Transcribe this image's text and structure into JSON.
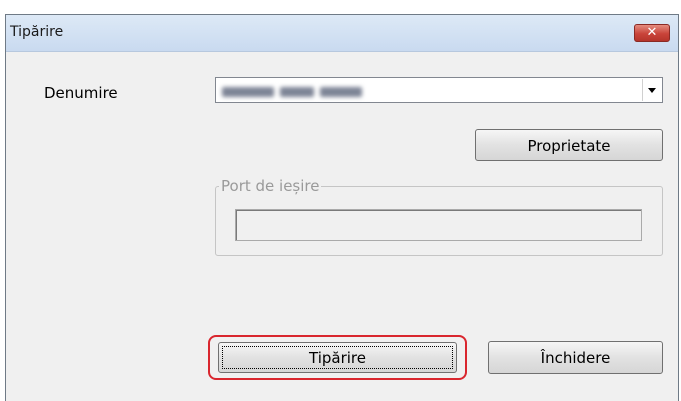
{
  "window": {
    "title": "Tipărire",
    "close_icon": "close-icon"
  },
  "form": {
    "name_label": "Denumire",
    "printer_value": "",
    "properties_button": "Proprietate",
    "output_port_group": "Port de ieșire",
    "output_port_value": ""
  },
  "buttons": {
    "print": "Tipărire",
    "close": "Închidere"
  },
  "highlight": {
    "color": "#d9262e"
  }
}
